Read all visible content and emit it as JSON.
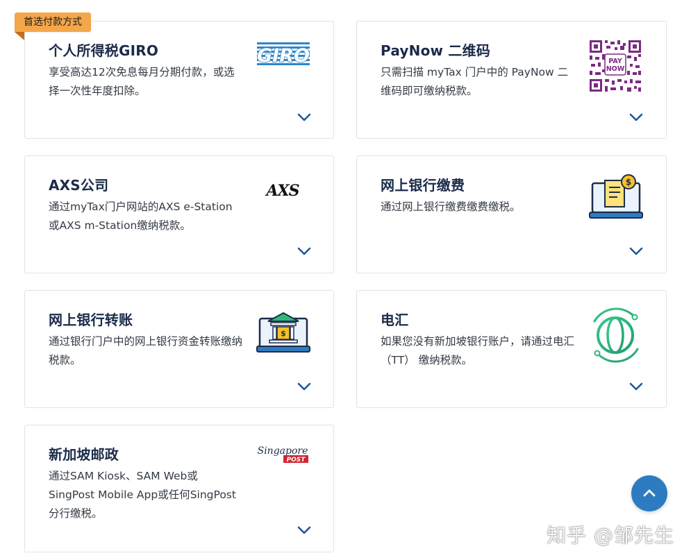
{
  "badge": {
    "label": "首选付款方式"
  },
  "cards": [
    {
      "title": "个人所得税GIRO",
      "desc": "享受高达12次免息每月分期付款，或选择一次性年度扣除。",
      "logo": "giro-logo"
    },
    {
      "title": "PayNow 二维码",
      "desc": "只需扫描 myTax 门户中的 PayNow 二维码即可缴纳税款。",
      "logo": "paynow-qr-code"
    },
    {
      "title": "AXS公司",
      "desc": "通过myTax门户网站的AXS e-Station或AXS m-Station缴纳税款。",
      "logo": "axs-logo"
    },
    {
      "title": "网上银行缴费",
      "desc": "通过网上银行缴费缴费缴税。",
      "logo": "bill-payment-icon"
    },
    {
      "title": "网上银行转账",
      "desc": "通过银行门户中的网上银行资金转账缴纳税款。",
      "logo": "bank-transfer-icon"
    },
    {
      "title": "电汇",
      "desc": "如果您没有新加坡银行账户，请通过电汇 （TT） 缴纳税款。",
      "logo": "globe-icon"
    },
    {
      "title": "新加坡邮政",
      "desc": "通过SAM Kiosk、SAM Web或SingPost Mobile App或任何SingPost分行缴税。",
      "logo": "singpost-logo"
    }
  ],
  "logos": {
    "giro": "GIRO",
    "paynow_line1": "PAY",
    "paynow_line2": "NOW",
    "axs": "AXS",
    "singpost_script": "Singapore",
    "singpost_post": "POST"
  },
  "watermark": "知乎 @邹先生",
  "colors": {
    "title": "#1c2b4a",
    "chevron": "#1d5a96",
    "badge": "#f4a64a",
    "scroll_top": "#2d7cc1",
    "giro_blue": "#2c86c7",
    "paynow_purple": "#7b2a82",
    "singpost_red": "#d22630",
    "globe_green": "#2fb87a"
  }
}
